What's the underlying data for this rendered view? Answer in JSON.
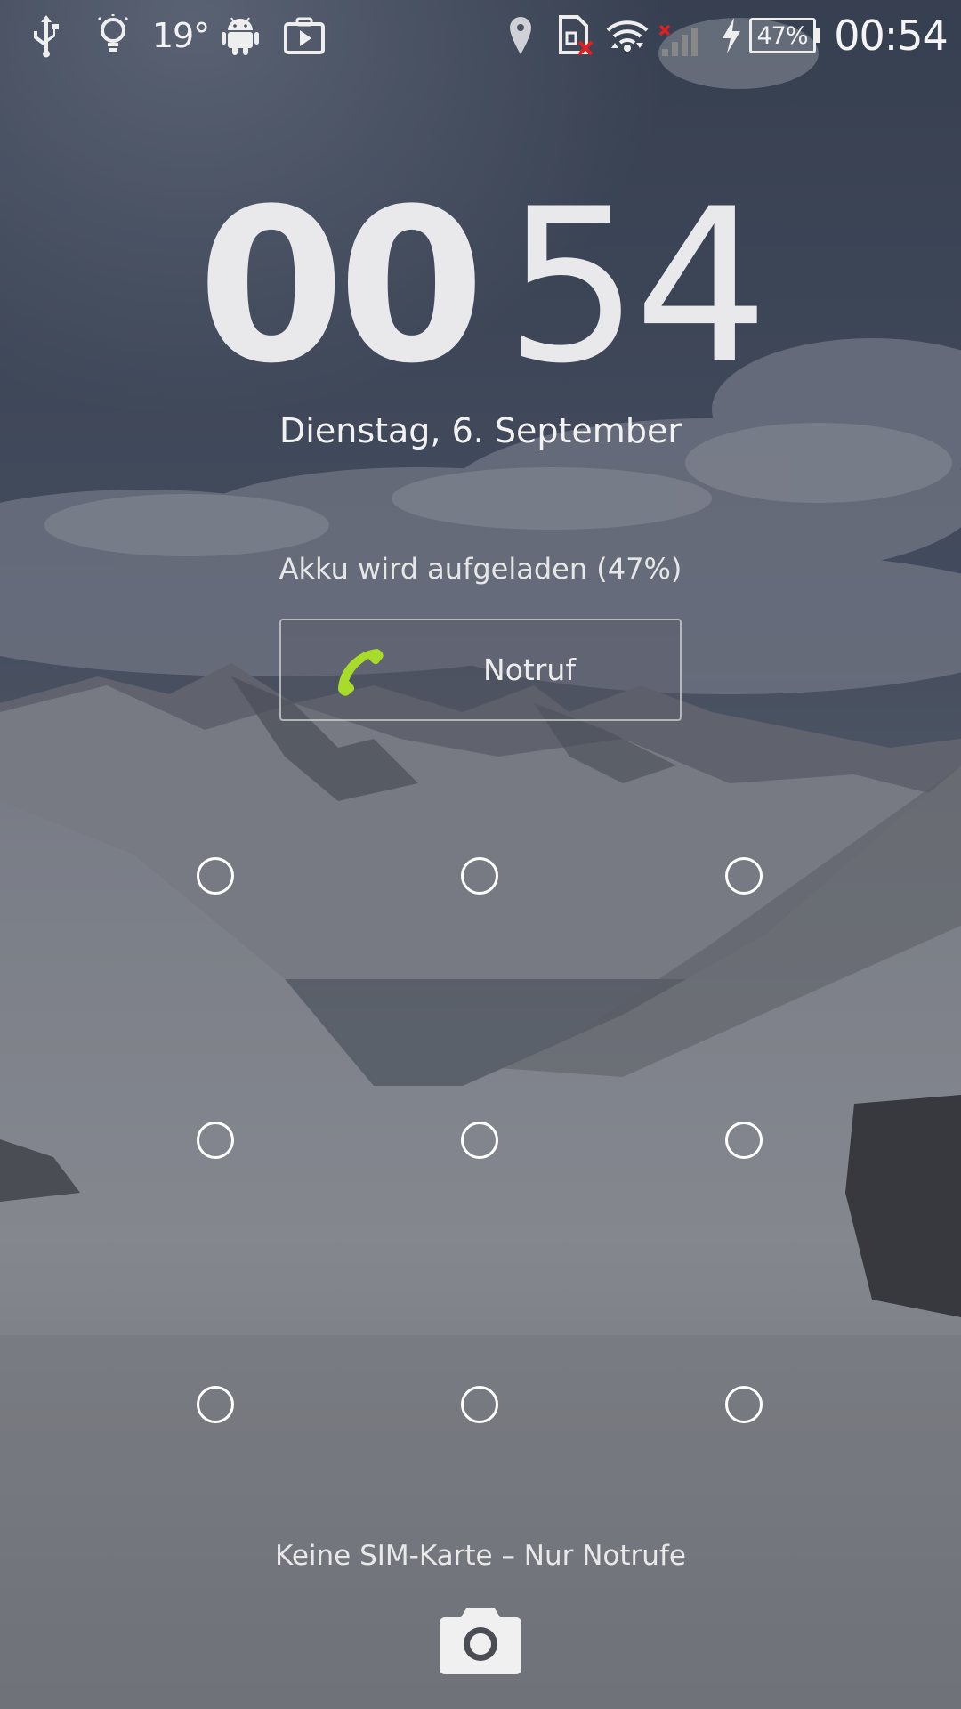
{
  "status_bar": {
    "temperature": "19°",
    "battery_percent": "47%",
    "time": "00:54",
    "icons": [
      "usb-icon",
      "lightbulb-icon",
      "android-icon",
      "video-icon",
      "location-pin-icon",
      "no-sim-card-icon",
      "wifi-icon",
      "signal-icon",
      "charging-bolt-icon",
      "battery-icon"
    ]
  },
  "lockscreen": {
    "clock_hours": "00",
    "clock_minutes": "54",
    "date": "Dienstag, 6. September",
    "charging_status": "Akku wird aufgeladen (47%)",
    "emergency_button_label": "Notruf",
    "pattern_dots": 9,
    "sim_status": "Keine SIM-Karte – Nur Notrufe"
  },
  "colors": {
    "emergency_phone": "#a8dc2a",
    "missing_indicator": "#e02020",
    "text": "#ffffff"
  }
}
